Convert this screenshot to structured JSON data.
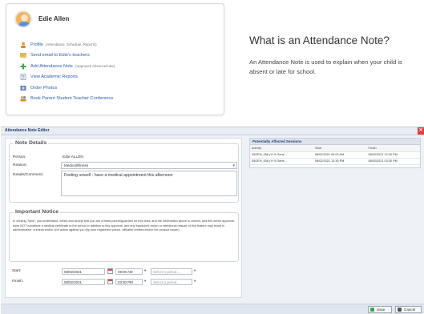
{
  "profile": {
    "name": "Edie Allen",
    "items": [
      {
        "label": "Profile",
        "note": "(Attendance, Schedule, Reports)",
        "icon": "profile-icon"
      },
      {
        "label": "Send email to Edie's teachers",
        "note": "",
        "icon": "email-icon"
      },
      {
        "label": "Add Attendance Note",
        "note": "(Approved Absence/Late)",
        "icon": "plus-icon"
      },
      {
        "label": "View Academic Reports",
        "note": "",
        "icon": "reports-icon"
      },
      {
        "label": "Order Photos",
        "note": "",
        "icon": "photos-icon"
      },
      {
        "label": "Book Parent Student Teacher Conference",
        "note": "",
        "icon": "conference-icon"
      }
    ]
  },
  "info": {
    "title": "What is an Attendance Note?",
    "text": "An Attendance Note is used to explain when your child is absent or late for school."
  },
  "editor": {
    "title": "Attendance Note Editor",
    "details": {
      "legend": "Note Details",
      "person_label": "Person:",
      "person_value": "Edie ALLEN",
      "reason_label": "Reason:",
      "reason_value": "Medical/Illness",
      "comment_label": "Details/Comment:",
      "comment_value": "Feeling unwell - have a medical appointment this afternoon"
    },
    "notice": {
      "legend": "Important Notice",
      "text": "In clicking 'Save', you understand, certify and accept that you are a listed parent/guardian for this child; and the information above is correct; and this online approval does NOT constitute a medical certificate to the school in addition to this approval; and any fraudulent action or intentional misuse of this feature may result in administrative, criminal and/or civil action against you (by your registered school, affiliated entities and/or the product issuer)."
    },
    "start": {
      "label": "Start:",
      "date": "08/02/2021",
      "time": "09:00 AM",
      "period_placeholder": "Select a period..."
    },
    "finish": {
      "label": "Finish:",
      "date": "08/02/2021",
      "time": "03:30 PM",
      "period_placeholder": "Select a period..."
    },
    "sessions": {
      "title": "Potentially Affected Sessions",
      "columns": [
        "Activity",
        "Start",
        "Finish"
      ],
      "rows": [
        [
          "05GEN_05A (Yr 5 Gene...",
          "08/02/2021 09:00 AM",
          "08/02/2021 12:00 PM"
        ],
        [
          "05GEN_05A (Yr 5 Gene...",
          "08/02/2021 12:30 PM",
          "08/02/2021 03:30 PM"
        ]
      ]
    },
    "buttons": {
      "save": "Save",
      "cancel": "Cancel"
    },
    "colors": {
      "accent": "#2a5db0",
      "close": "#e04040",
      "save_icon": "#3aa64a",
      "cancel_icon": "#555555"
    }
  }
}
